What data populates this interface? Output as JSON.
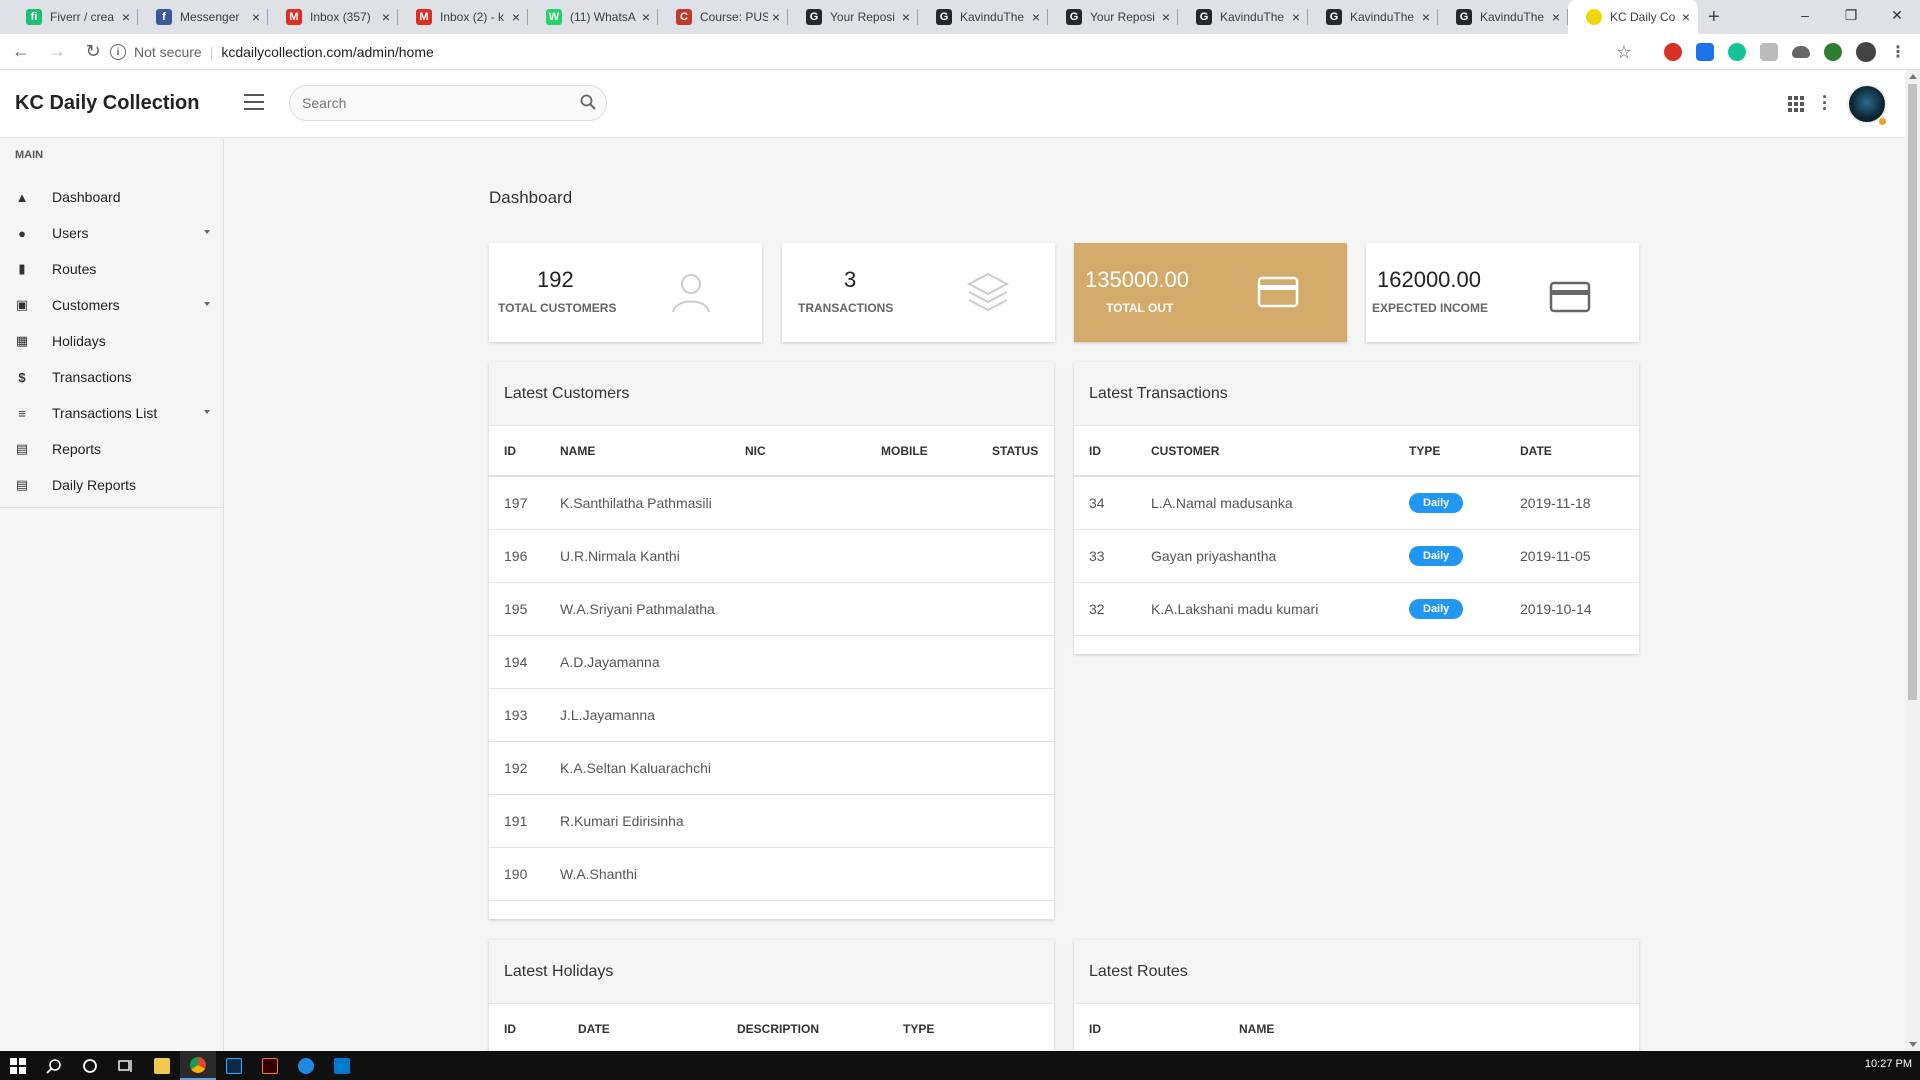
{
  "browser": {
    "tabs": [
      {
        "title": "Fiverr / crea",
        "icon": "fiverr-icon",
        "color": "#1dbf73",
        "glyph": "fi"
      },
      {
        "title": "Messenger",
        "icon": "facebook-icon",
        "color": "#3b5998",
        "glyph": "f"
      },
      {
        "title": "Inbox (357)",
        "icon": "gmail-icon",
        "color": "#d93025",
        "glyph": "M"
      },
      {
        "title": "Inbox (2) - k",
        "icon": "gmail-icon",
        "color": "#d93025",
        "glyph": "M"
      },
      {
        "title": "(11) WhatsA",
        "icon": "whatsapp-icon",
        "color": "#25d366",
        "glyph": "W"
      },
      {
        "title": "Course: PUS",
        "icon": "course-shield-icon",
        "color": "#c0392b",
        "glyph": "C"
      },
      {
        "title": "Your Reposi",
        "icon": "github-icon",
        "color": "#24292e",
        "glyph": "G"
      },
      {
        "title": "KavinduThe",
        "icon": "github-icon",
        "color": "#24292e",
        "glyph": "G"
      },
      {
        "title": "Your Reposi",
        "icon": "github-icon",
        "color": "#24292e",
        "glyph": "G"
      },
      {
        "title": "KavinduThe",
        "icon": "github-icon",
        "color": "#24292e",
        "glyph": "G"
      },
      {
        "title": "KavinduThe",
        "icon": "github-icon",
        "color": "#24292e",
        "glyph": "G"
      },
      {
        "title": "KavinduThe",
        "icon": "github-icon",
        "color": "#24292e",
        "glyph": "G"
      },
      {
        "title": "KC Daily Co",
        "icon": "kc-site-icon",
        "color": "#f2d600",
        "glyph": "",
        "active": true
      }
    ],
    "security_label": "Not secure",
    "url": "kcdailycollection.com/admin/home"
  },
  "header": {
    "brand": "KC Daily Collection",
    "search_placeholder": "Search"
  },
  "sidebar": {
    "heading": "MAIN",
    "items": [
      {
        "label": "Dashboard",
        "icon": "dashboard-icon",
        "glyph": "▲",
        "caret": false
      },
      {
        "label": "Users",
        "icon": "user-icon",
        "glyph": "●",
        "caret": true
      },
      {
        "label": "Routes",
        "icon": "map-icon",
        "glyph": "▮",
        "caret": false
      },
      {
        "label": "Customers",
        "icon": "contact-icon",
        "glyph": "▣",
        "caret": true
      },
      {
        "label": "Holidays",
        "icon": "calendar-icon",
        "glyph": "▦",
        "caret": false
      },
      {
        "label": "Transactions",
        "icon": "dollar-icon",
        "glyph": "$",
        "caret": false
      },
      {
        "label": "Transactions List",
        "icon": "list-icon",
        "glyph": "≡",
        "caret": true
      },
      {
        "label": "Reports",
        "icon": "document-icon",
        "glyph": "▤",
        "caret": false
      },
      {
        "label": "Daily Reports",
        "icon": "document-icon",
        "glyph": "▤",
        "caret": false
      }
    ]
  },
  "main": {
    "title": "Dashboard",
    "stats": {
      "customers": {
        "value": "192",
        "label": "TOTAL CUSTOMERS"
      },
      "transactions": {
        "value": "3",
        "label": "TRANSACTIONS"
      },
      "total_out": {
        "value": "135000.00",
        "label": "TOTAL OUT"
      },
      "expected_income": {
        "value": "162000.00",
        "label": "EXPECTED INCOME"
      }
    },
    "latest_customers": {
      "title": "Latest Customers",
      "columns": [
        "ID",
        "NAME",
        "NIC",
        "MOBILE",
        "STATUS"
      ],
      "rows": [
        {
          "id": "197",
          "name": "K.Santhilatha Pathmasili"
        },
        {
          "id": "196",
          "name": "U.R.Nirmala Kanthi"
        },
        {
          "id": "195",
          "name": "W.A.Sriyani Pathmalatha"
        },
        {
          "id": "194",
          "name": "A.D.Jayamanna"
        },
        {
          "id": "193",
          "name": "J.L.Jayamanna"
        },
        {
          "id": "192",
          "name": "K.A.Seltan Kaluarachchi"
        },
        {
          "id": "191",
          "name": "R.Kumari Edirisinha"
        },
        {
          "id": "190",
          "name": "W.A.Shanthi"
        }
      ]
    },
    "latest_transactions": {
      "title": "Latest Transactions",
      "columns": [
        "ID",
        "CUSTOMER",
        "TYPE",
        "DATE"
      ],
      "rows": [
        {
          "id": "34",
          "customer": "L.A.Namal madusanka",
          "type": "Daily",
          "date": "2019-11-18"
        },
        {
          "id": "33",
          "customer": "Gayan priyashantha",
          "type": "Daily",
          "date": "2019-11-05"
        },
        {
          "id": "32",
          "customer": "K.A.Lakshani madu kumari",
          "type": "Daily",
          "date": "2019-10-14"
        }
      ]
    },
    "latest_holidays": {
      "title": "Latest Holidays",
      "columns": [
        "ID",
        "DATE",
        "DESCRIPTION",
        "TYPE"
      ]
    },
    "latest_routes": {
      "title": "Latest Routes",
      "columns": [
        "ID",
        "NAME"
      ]
    }
  },
  "taskbar": {
    "time": "10:27 PM"
  },
  "colors": {
    "accent_gold": "#d4aa6a",
    "badge_blue": "#2196f3"
  }
}
